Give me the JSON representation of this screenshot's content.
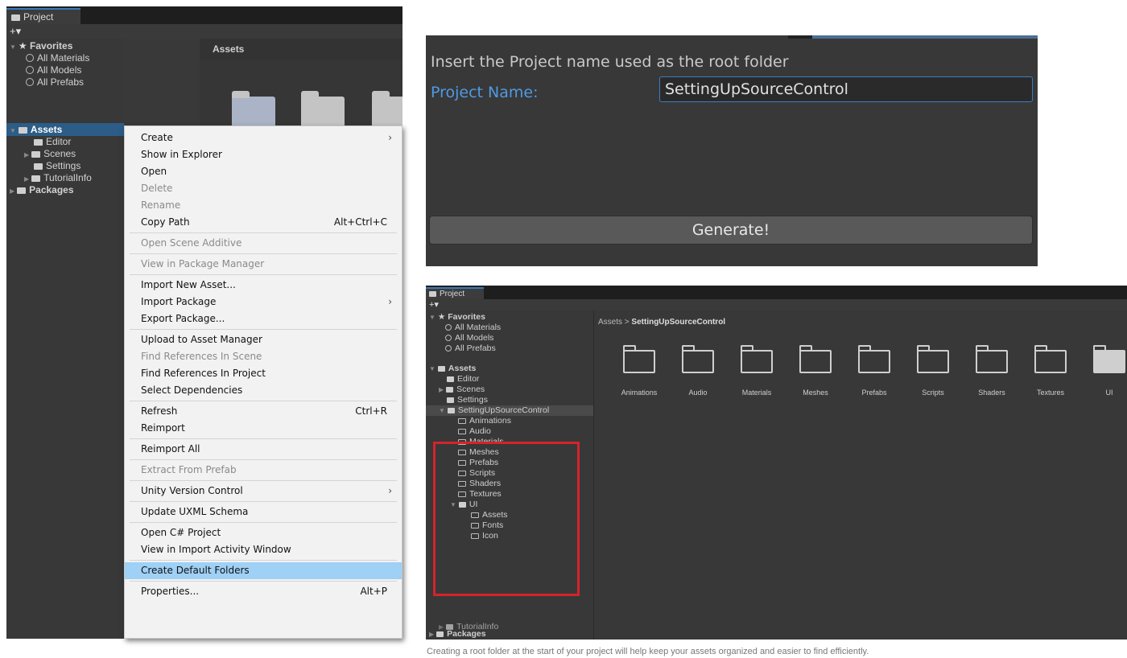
{
  "left_panel": {
    "tab": "Project",
    "toolbar_plus": "+▾",
    "tree": {
      "favorites": "Favorites",
      "all_materials": "All Materials",
      "all_models": "All Models",
      "all_prefabs": "All Prefabs",
      "assets": "Assets",
      "editor": "Editor",
      "scenes": "Scenes",
      "settings": "Settings",
      "tutorialinfo": "TutorialInfo",
      "packages": "Packages"
    },
    "assets_header": "Assets",
    "context_menu": {
      "items": [
        {
          "label": "Create",
          "shortcut": "",
          "submenu": true,
          "disabled": false
        },
        {
          "label": "Show in Explorer",
          "shortcut": "",
          "submenu": false,
          "disabled": false
        },
        {
          "label": "Open",
          "shortcut": "",
          "submenu": false,
          "disabled": false
        },
        {
          "label": "Delete",
          "shortcut": "",
          "submenu": false,
          "disabled": true
        },
        {
          "label": "Rename",
          "shortcut": "",
          "submenu": false,
          "disabled": true
        },
        {
          "label": "Copy Path",
          "shortcut": "Alt+Ctrl+C",
          "submenu": false,
          "disabled": false
        },
        {
          "label": "Open Scene Additive",
          "shortcut": "",
          "submenu": false,
          "disabled": true
        },
        {
          "label": "View in Package Manager",
          "shortcut": "",
          "submenu": false,
          "disabled": true
        },
        {
          "label": "Import New Asset...",
          "shortcut": "",
          "submenu": false,
          "disabled": false
        },
        {
          "label": "Import Package",
          "shortcut": "",
          "submenu": true,
          "disabled": false
        },
        {
          "label": "Export Package...",
          "shortcut": "",
          "submenu": false,
          "disabled": false
        },
        {
          "label": "Upload to Asset Manager",
          "shortcut": "",
          "submenu": false,
          "disabled": false
        },
        {
          "label": "Find References In Scene",
          "shortcut": "",
          "submenu": false,
          "disabled": true
        },
        {
          "label": "Find References In Project",
          "shortcut": "",
          "submenu": false,
          "disabled": false
        },
        {
          "label": "Select Dependencies",
          "shortcut": "",
          "submenu": false,
          "disabled": false
        },
        {
          "label": "Refresh",
          "shortcut": "Ctrl+R",
          "submenu": false,
          "disabled": false
        },
        {
          "label": "Reimport",
          "shortcut": "",
          "submenu": false,
          "disabled": false
        },
        {
          "label": "Reimport All",
          "shortcut": "",
          "submenu": false,
          "disabled": false
        },
        {
          "label": "Extract From Prefab",
          "shortcut": "",
          "submenu": false,
          "disabled": true
        },
        {
          "label": "Unity Version Control",
          "shortcut": "",
          "submenu": true,
          "disabled": false
        },
        {
          "label": "Update UXML Schema",
          "shortcut": "",
          "submenu": false,
          "disabled": false
        },
        {
          "label": "Open C# Project",
          "shortcut": "",
          "submenu": false,
          "disabled": false
        },
        {
          "label": "View in Import Activity Window",
          "shortcut": "",
          "submenu": false,
          "disabled": false
        },
        {
          "label": "Create Default Folders",
          "shortcut": "",
          "submenu": false,
          "disabled": false,
          "highlighted": true
        },
        {
          "label": "Properties...",
          "shortcut": "Alt+P",
          "submenu": false,
          "disabled": false
        }
      ]
    }
  },
  "dialog": {
    "heading": "Insert the Project name used as the root folder",
    "label": "Project Name:",
    "input_value": "SettingUpSourceControl",
    "button": "Generate!"
  },
  "right_panel": {
    "tab": "Project",
    "toolbar_plus": "+▾",
    "breadcrumb_root": "Assets",
    "breadcrumb_sep": ">",
    "breadcrumb_current": "SettingUpSourceControl",
    "tree": {
      "favorites": "Favorites",
      "all_materials": "All Materials",
      "all_models": "All Models",
      "all_prefabs": "All Prefabs",
      "assets": "Assets",
      "editor": "Editor",
      "scenes": "Scenes",
      "settings": "Settings",
      "root": "SettingUpSourceControl",
      "children": [
        "Animations",
        "Audio",
        "Materials",
        "Meshes",
        "Prefabs",
        "Scripts",
        "Shaders",
        "Textures"
      ],
      "ui": "UI",
      "ui_children": [
        "Assets",
        "Fonts",
        "Icon"
      ],
      "tutorialinfo": "TutorialInfo",
      "packages": "Packages"
    },
    "folders": [
      "Animations",
      "Audio",
      "Materials",
      "Meshes",
      "Prefabs",
      "Scripts",
      "Shaders",
      "Textures",
      "UI"
    ]
  },
  "caption": "Creating a root folder at the start of your project will help keep your assets organized and easier to find efficiently.",
  "colors": {
    "accent": "#3a79bb",
    "highlight": "#9fd0f5",
    "label_blue": "#4f9ae4",
    "red_box": "#d5232b"
  }
}
